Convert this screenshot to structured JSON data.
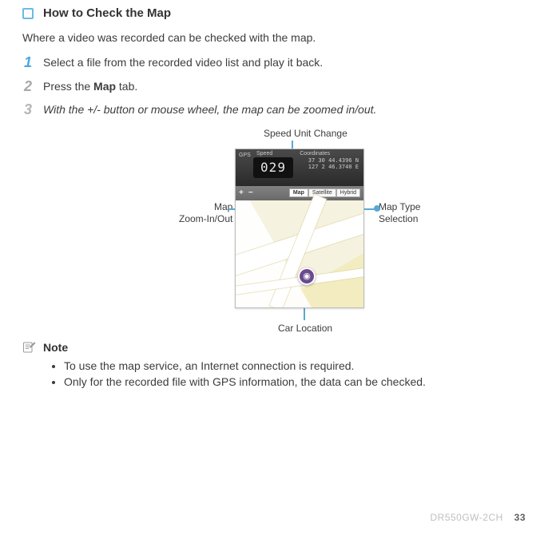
{
  "title": "How to Check the Map",
  "intro": "Where a video was recorded can be checked with the map.",
  "steps": {
    "s1": "Select a file from the recorded video list and play it back.",
    "s2_pre": "Press the ",
    "s2_bold": "Map",
    "s2_post": " tab.",
    "s3": "With the +/- button or mouse wheel, the map can be zoomed in/out."
  },
  "labels": {
    "speed": "Speed Unit Change",
    "zoom_l1": "Map",
    "zoom_l2": "Zoom-In/Out",
    "type_l1": "Map Type",
    "type_l2": "Selection",
    "car": "Car Location"
  },
  "screenshot": {
    "top_labels": {
      "gps": "GPS",
      "speed": "Speed",
      "coord": "Coordinates"
    },
    "speed_value": "029",
    "coord_lat": "37 30 44.4396 N",
    "coord_lon": "127 2 46.3740 E",
    "zoom_plus": "+",
    "zoom_minus": "−",
    "map_tabs": {
      "map": "Map",
      "sat": "Satellite",
      "hyb": "Hybrid"
    },
    "pin_glyph": "◉"
  },
  "note": {
    "heading": "Note",
    "items": [
      "To use the map service, an Internet connection is required.",
      "Only for the recorded file with GPS information, the data can be checked."
    ]
  },
  "footer": {
    "model": "DR550GW-2CH",
    "page": "33"
  }
}
